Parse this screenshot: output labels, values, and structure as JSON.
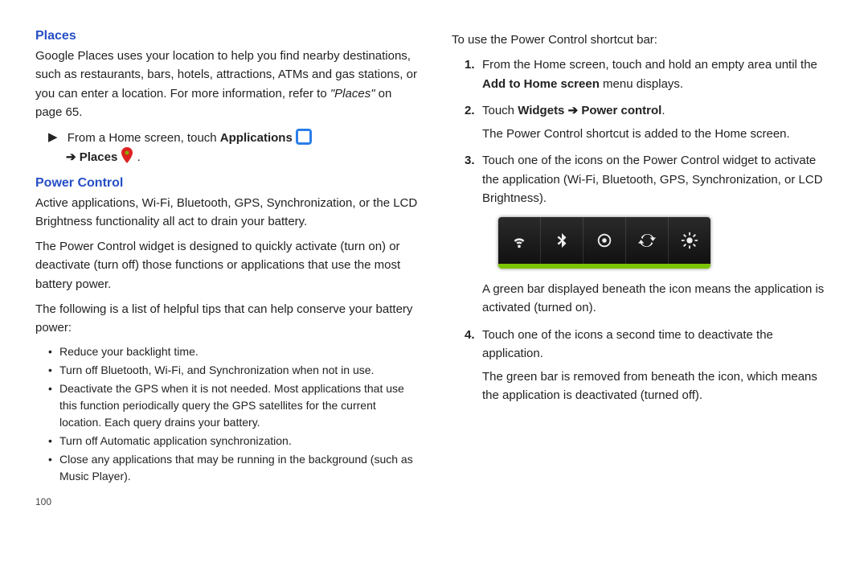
{
  "page_number": "100",
  "left": {
    "places": {
      "heading": "Places",
      "body": "Google Places uses your location to help you find nearby destinations, such as restaurants, bars, hotels, attractions, ATMs and gas stations, or you can enter a location. For more information, refer to ",
      "ref": "\"Places\"",
      "body_tail": " on page 65.",
      "step_lead": "From a Home screen, touch ",
      "step_apps": "Applications",
      "step_arrow": "➔",
      "step_places": "Places",
      "step_period": "."
    },
    "power": {
      "heading": "Power Control",
      "p1": "Active applications, Wi-Fi, Bluetooth, GPS, Synchronization, or the LCD Brightness functionality all act to drain your battery.",
      "p2": "The Power Control widget is designed to quickly activate (turn on) or deactivate (turn off) those functions or applications that use the most battery power.",
      "p3": "The following is a list of helpful tips that can help conserve your battery power:",
      "tips": [
        "Reduce your backlight time.",
        "Turn off Bluetooth, Wi-Fi, and Synchronization when not in use.",
        "Deactivate the GPS when it is not needed. Most applications that use this function periodically query the GPS satellites for the current location. Each query drains your battery.",
        "Turn off Automatic application synchronization.",
        "Close any applications that may be running in the background (such as Music Player)."
      ]
    }
  },
  "right": {
    "intro": "To use the Power Control shortcut bar:",
    "steps": {
      "n1": "1.",
      "s1a": "From the Home screen, touch and hold an empty area until the ",
      "s1b": "Add to Home screen",
      "s1c": " menu displays.",
      "n2": "2.",
      "s2a": "Touch ",
      "s2b": "Widgets",
      "s2arrow": " ➔ ",
      "s2c": "Power control",
      "s2d": ".",
      "s2follow": "The Power Control shortcut is added to the Home screen.",
      "n3": "3.",
      "s3": "Touch one of the icons on the Power Control widget to activate the application (Wi-Fi, Bluetooth, GPS, Synchronization, or LCD Brightness).",
      "s3follow": "A green bar displayed beneath the icon means the application is activated (turned on).",
      "n4": "4.",
      "s4": "Touch one of the icons a second time to deactivate the application.",
      "s4follow": "The green bar is removed from beneath the icon, which means the application is deactivated (turned off)."
    }
  }
}
